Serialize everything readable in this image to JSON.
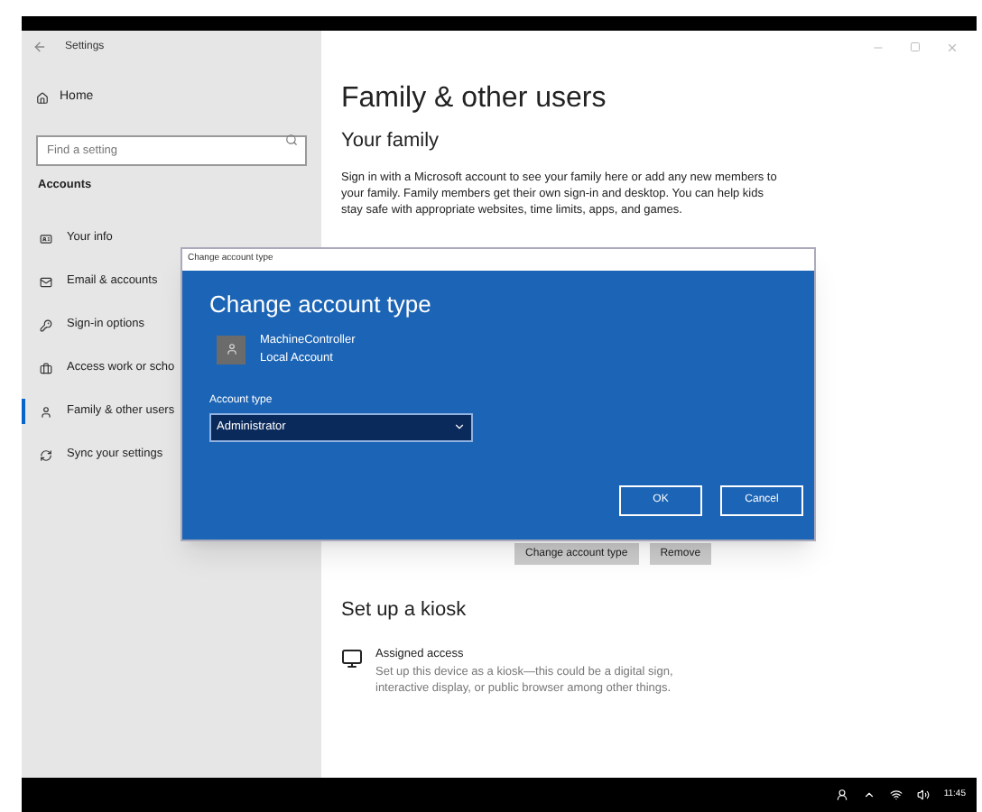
{
  "window": {
    "title": "Settings"
  },
  "sidebar": {
    "home": "Home",
    "search": {
      "placeholder": "Find a setting"
    },
    "section": "Accounts",
    "items": [
      {
        "label": "Your info",
        "selected": false
      },
      {
        "label": "Email & accounts",
        "selected": false
      },
      {
        "label": "Sign-in options",
        "selected": false
      },
      {
        "label": "Access work or scho",
        "selected": false
      },
      {
        "label": "Family & other users",
        "selected": true
      },
      {
        "label": "Sync your settings",
        "selected": false
      }
    ]
  },
  "content": {
    "title": "Family & other users",
    "family_heading": "Your family",
    "family_text": "Sign in with a Microsoft account to see your family here or add any new members to your family. Family members get their own sign-in and desktop. You can help kids stay safe with appropriate websites, time limits, apps, and games.",
    "user_buttons": [
      "Change account type",
      "Remove"
    ],
    "kiosk_heading": "Set up a kiosk",
    "kiosk_item": {
      "title": "Assigned access",
      "text": "Set up this device as a kiosk—this could be a digital sign, interactive display, or public browser among other things."
    }
  },
  "dialog": {
    "title": "Change account type",
    "heading": "Change account type",
    "user_name": "MachineController",
    "user_type": "Local Account",
    "field_label": "Account type",
    "value": "Administrator",
    "buttons": [
      "OK",
      "Cancel"
    ]
  },
  "taskbar": {
    "time": "11:45"
  }
}
